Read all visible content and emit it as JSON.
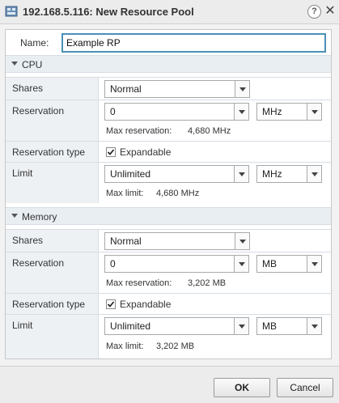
{
  "dialog": {
    "title": "192.168.5.116: New Resource Pool",
    "help_glyph": "?",
    "close_glyph": "✕"
  },
  "name": {
    "label": "Name:",
    "value": "Example RP"
  },
  "cpu": {
    "header": "CPU",
    "shares": {
      "label": "Shares",
      "value": "Normal"
    },
    "reservation": {
      "label": "Reservation",
      "value": "0",
      "unit": "MHz",
      "max_label": "Max reservation:",
      "max_value": "4,680 MHz"
    },
    "reservation_type": {
      "label": "Reservation type",
      "checkbox_label": "Expandable",
      "checked": true
    },
    "limit": {
      "label": "Limit",
      "value": "Unlimited",
      "unit": "MHz",
      "max_label": "Max limit:",
      "max_value": "4,680 MHz"
    }
  },
  "memory": {
    "header": "Memory",
    "shares": {
      "label": "Shares",
      "value": "Normal"
    },
    "reservation": {
      "label": "Reservation",
      "value": "0",
      "unit": "MB",
      "max_label": "Max reservation:",
      "max_value": "3,202 MB"
    },
    "reservation_type": {
      "label": "Reservation type",
      "checkbox_label": "Expandable",
      "checked": true
    },
    "limit": {
      "label": "Limit",
      "value": "Unlimited",
      "unit": "MB",
      "max_label": "Max limit:",
      "max_value": "3,202 MB"
    }
  },
  "buttons": {
    "ok": "OK",
    "cancel": "Cancel"
  },
  "colors": {
    "focus_border": "#4a90b8",
    "section_bg": "#e9eef3",
    "row_label_bg": "#eef1f4"
  },
  "icons": {
    "app": "resource-pool-icon",
    "help": "help-icon",
    "close": "close-icon",
    "collapse": "collapse-triangle-icon",
    "dropdown": "dropdown-arrow-icon",
    "checkbox": "checkbox-checked-icon"
  }
}
